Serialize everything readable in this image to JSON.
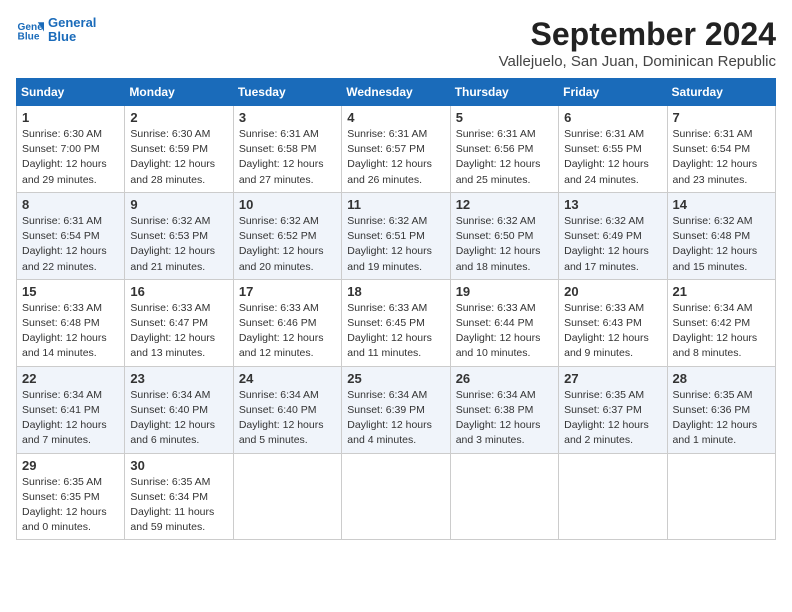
{
  "logo": {
    "line1": "General",
    "line2": "Blue"
  },
  "title": "September 2024",
  "subtitle": "Vallejuelo, San Juan, Dominican Republic",
  "days_header": [
    "Sunday",
    "Monday",
    "Tuesday",
    "Wednesday",
    "Thursday",
    "Friday",
    "Saturday"
  ],
  "weeks": [
    [
      {
        "day": "1",
        "sunrise": "6:30 AM",
        "sunset": "7:00 PM",
        "daylight": "12 hours and 29 minutes."
      },
      {
        "day": "2",
        "sunrise": "6:30 AM",
        "sunset": "6:59 PM",
        "daylight": "12 hours and 28 minutes."
      },
      {
        "day": "3",
        "sunrise": "6:31 AM",
        "sunset": "6:58 PM",
        "daylight": "12 hours and 27 minutes."
      },
      {
        "day": "4",
        "sunrise": "6:31 AM",
        "sunset": "6:57 PM",
        "daylight": "12 hours and 26 minutes."
      },
      {
        "day": "5",
        "sunrise": "6:31 AM",
        "sunset": "6:56 PM",
        "daylight": "12 hours and 25 minutes."
      },
      {
        "day": "6",
        "sunrise": "6:31 AM",
        "sunset": "6:55 PM",
        "daylight": "12 hours and 24 minutes."
      },
      {
        "day": "7",
        "sunrise": "6:31 AM",
        "sunset": "6:54 PM",
        "daylight": "12 hours and 23 minutes."
      }
    ],
    [
      {
        "day": "8",
        "sunrise": "6:31 AM",
        "sunset": "6:54 PM",
        "daylight": "12 hours and 22 minutes."
      },
      {
        "day": "9",
        "sunrise": "6:32 AM",
        "sunset": "6:53 PM",
        "daylight": "12 hours and 21 minutes."
      },
      {
        "day": "10",
        "sunrise": "6:32 AM",
        "sunset": "6:52 PM",
        "daylight": "12 hours and 20 minutes."
      },
      {
        "day": "11",
        "sunrise": "6:32 AM",
        "sunset": "6:51 PM",
        "daylight": "12 hours and 19 minutes."
      },
      {
        "day": "12",
        "sunrise": "6:32 AM",
        "sunset": "6:50 PM",
        "daylight": "12 hours and 18 minutes."
      },
      {
        "day": "13",
        "sunrise": "6:32 AM",
        "sunset": "6:49 PM",
        "daylight": "12 hours and 17 minutes."
      },
      {
        "day": "14",
        "sunrise": "6:32 AM",
        "sunset": "6:48 PM",
        "daylight": "12 hours and 15 minutes."
      }
    ],
    [
      {
        "day": "15",
        "sunrise": "6:33 AM",
        "sunset": "6:48 PM",
        "daylight": "12 hours and 14 minutes."
      },
      {
        "day": "16",
        "sunrise": "6:33 AM",
        "sunset": "6:47 PM",
        "daylight": "12 hours and 13 minutes."
      },
      {
        "day": "17",
        "sunrise": "6:33 AM",
        "sunset": "6:46 PM",
        "daylight": "12 hours and 12 minutes."
      },
      {
        "day": "18",
        "sunrise": "6:33 AM",
        "sunset": "6:45 PM",
        "daylight": "12 hours and 11 minutes."
      },
      {
        "day": "19",
        "sunrise": "6:33 AM",
        "sunset": "6:44 PM",
        "daylight": "12 hours and 10 minutes."
      },
      {
        "day": "20",
        "sunrise": "6:33 AM",
        "sunset": "6:43 PM",
        "daylight": "12 hours and 9 minutes."
      },
      {
        "day": "21",
        "sunrise": "6:34 AM",
        "sunset": "6:42 PM",
        "daylight": "12 hours and 8 minutes."
      }
    ],
    [
      {
        "day": "22",
        "sunrise": "6:34 AM",
        "sunset": "6:41 PM",
        "daylight": "12 hours and 7 minutes."
      },
      {
        "day": "23",
        "sunrise": "6:34 AM",
        "sunset": "6:40 PM",
        "daylight": "12 hours and 6 minutes."
      },
      {
        "day": "24",
        "sunrise": "6:34 AM",
        "sunset": "6:40 PM",
        "daylight": "12 hours and 5 minutes."
      },
      {
        "day": "25",
        "sunrise": "6:34 AM",
        "sunset": "6:39 PM",
        "daylight": "12 hours and 4 minutes."
      },
      {
        "day": "26",
        "sunrise": "6:34 AM",
        "sunset": "6:38 PM",
        "daylight": "12 hours and 3 minutes."
      },
      {
        "day": "27",
        "sunrise": "6:35 AM",
        "sunset": "6:37 PM",
        "daylight": "12 hours and 2 minutes."
      },
      {
        "day": "28",
        "sunrise": "6:35 AM",
        "sunset": "6:36 PM",
        "daylight": "12 hours and 1 minute."
      }
    ],
    [
      {
        "day": "29",
        "sunrise": "6:35 AM",
        "sunset": "6:35 PM",
        "daylight": "12 hours and 0 minutes."
      },
      {
        "day": "30",
        "sunrise": "6:35 AM",
        "sunset": "6:34 PM",
        "daylight": "11 hours and 59 minutes."
      },
      null,
      null,
      null,
      null,
      null
    ]
  ]
}
